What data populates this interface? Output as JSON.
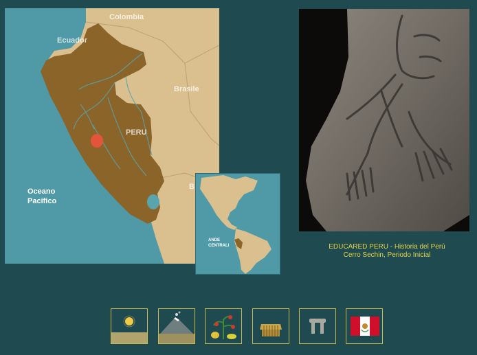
{
  "map": {
    "labels": {
      "colombia": "Colombia",
      "ecuador": "Ecuador",
      "brasile": "Brasile",
      "peru": "PERU",
      "bolivia_partial": "B",
      "ocean_line1": "Oceano",
      "ocean_line2": "Pacifico"
    },
    "inset_label_line1": "ANDE",
    "inset_label_line2": "CENTRALI"
  },
  "caption": {
    "line1": "EDUCARED PERU - Historia del Perú",
    "line2": "Cerro Sechin, Periodo Inicial"
  },
  "navbar": {
    "buttons": [
      {
        "name": "sun",
        "icon": "sun-landscape-icon"
      },
      {
        "name": "volcano",
        "icon": "volcano-icon"
      },
      {
        "name": "plants",
        "icon": "plants-fruits-icon"
      },
      {
        "name": "hut",
        "icon": "hut-icon"
      },
      {
        "name": "monument",
        "icon": "dolmen-icon"
      },
      {
        "name": "flag",
        "icon": "peru-flag-icon"
      }
    ]
  },
  "colors": {
    "background": "#1f4a50",
    "ocean": "#4f9aa6",
    "land": "#d9c08e",
    "peru": "#8a6428",
    "caption": "#e4d44a",
    "button_border": "#c8b94a"
  }
}
